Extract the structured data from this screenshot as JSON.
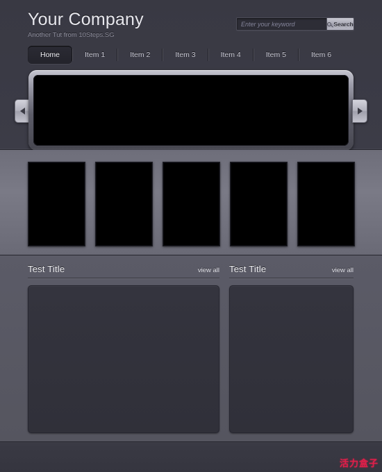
{
  "header": {
    "brand_title": "Your Company",
    "brand_subtitle": "Another Tut from 10Steps.SG"
  },
  "search": {
    "placeholder": "Enter your keyword",
    "value": "",
    "button_label": "Search",
    "icon": "magnifier-icon"
  },
  "nav": {
    "items": [
      {
        "label": "Home",
        "active": true
      },
      {
        "label": "Item 1",
        "active": false
      },
      {
        "label": "Item 2",
        "active": false
      },
      {
        "label": "Item 3",
        "active": false
      },
      {
        "label": "Item 4",
        "active": false
      },
      {
        "label": "Item 5",
        "active": false
      },
      {
        "label": "Item 6",
        "active": false
      }
    ]
  },
  "slider": {
    "prev_icon": "chevron-left-icon",
    "next_icon": "chevron-right-icon",
    "screen_color": "#000000"
  },
  "thumbnails": {
    "count": 5,
    "items": [
      {
        "id": "thumb-1"
      },
      {
        "id": "thumb-2"
      },
      {
        "id": "thumb-3"
      },
      {
        "id": "thumb-4"
      },
      {
        "id": "thumb-5"
      }
    ]
  },
  "content": {
    "columns": [
      {
        "title": "Test Title",
        "view_all_label": "view all"
      },
      {
        "title": "Test Title",
        "view_all_label": "view all"
      }
    ]
  },
  "footer": {
    "watermark": "活力盒子",
    "watermark_color": "#e01f4a"
  }
}
